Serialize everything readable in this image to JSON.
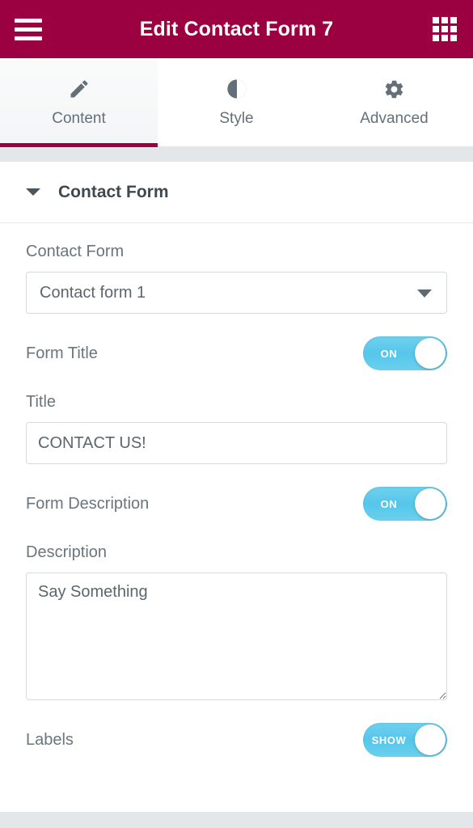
{
  "header": {
    "title": "Edit Contact Form 7",
    "menu_icon": "hamburger-menu-icon",
    "apps_icon": "grid-apps-icon",
    "background_color": "#9b0040"
  },
  "tabs": [
    {
      "label": "Content",
      "icon": "pencil-icon",
      "active": true
    },
    {
      "label": "Style",
      "icon": "contrast-icon",
      "active": false
    },
    {
      "label": "Advanced",
      "icon": "gear-icon",
      "active": false
    }
  ],
  "section": {
    "title": "Contact Form",
    "collapse_icon": "caret-down-icon",
    "expanded": true
  },
  "controls": {
    "contact_form": {
      "label": "Contact Form",
      "value": "Contact form 1",
      "dropdown_icon": "caret-down-icon"
    },
    "form_title_toggle": {
      "label": "Form Title",
      "state_label": "ON",
      "on": true
    },
    "title": {
      "label": "Title",
      "value": "CONTACT US!",
      "placeholder": ""
    },
    "form_description_toggle": {
      "label": "Form Description",
      "state_label": "ON",
      "on": true
    },
    "description": {
      "label": "Description",
      "value": "Say Something",
      "placeholder": ""
    },
    "labels_toggle": {
      "label": "Labels",
      "state_label": "SHOW",
      "on": true
    }
  },
  "colors": {
    "brand": "#9b0040",
    "toggle_on": "#56c6ea",
    "panel_bg": "#ffffff",
    "band": "#e3e7ea",
    "label_text": "#6a757e"
  }
}
